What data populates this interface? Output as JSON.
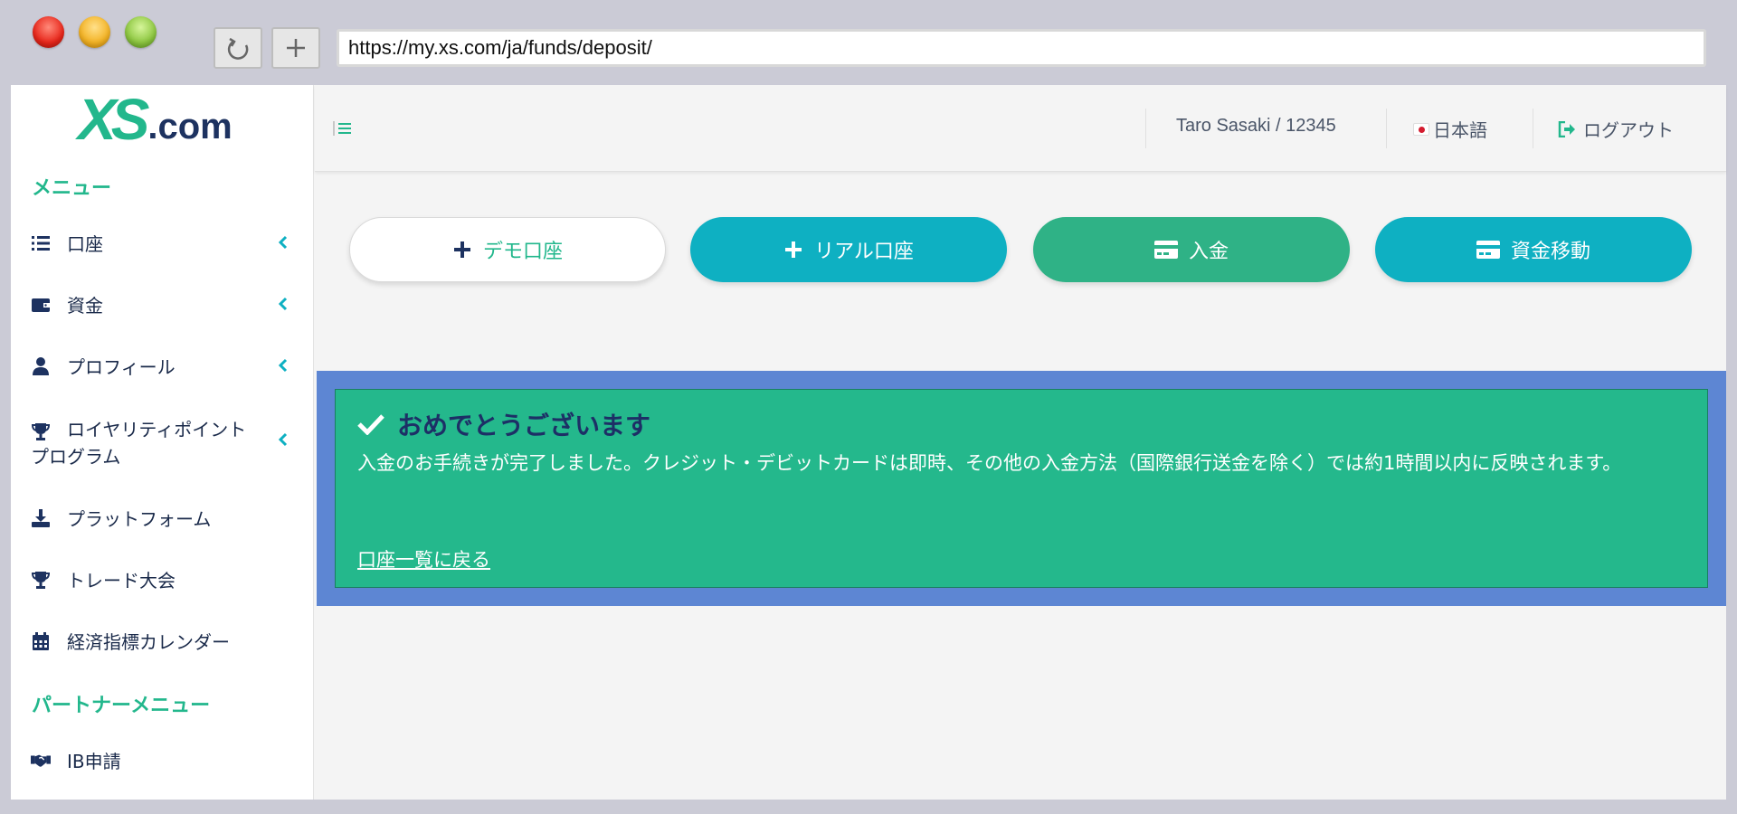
{
  "browser": {
    "url": "https://my.xs.com/ja/funds/deposit/",
    "reload_icon": "reload-icon",
    "new_tab_icon": "plus-icon"
  },
  "brand": {
    "logo_main": "XS",
    "logo_suffix": ".com",
    "primary_color": "#22b78c",
    "navy_color": "#1d3260"
  },
  "sidebar": {
    "menu_heading": "メニュー",
    "items": [
      {
        "label": "口座",
        "icon": "list-icon",
        "has_chevron": true
      },
      {
        "label": "資金",
        "icon": "wallet-icon",
        "has_chevron": true
      },
      {
        "label": "プロフィール",
        "icon": "user-icon",
        "has_chevron": true
      },
      {
        "label": "ロイヤリティポイントプログラム",
        "icon": "trophy-icon",
        "has_chevron": true
      },
      {
        "label": "プラットフォーム",
        "icon": "download-icon",
        "has_chevron": false
      },
      {
        "label": "トレード大会",
        "icon": "trophy-icon",
        "has_chevron": false
      },
      {
        "label": "経済指標カレンダー",
        "icon": "calendar-icon",
        "has_chevron": false
      }
    ],
    "partner_heading": "パートナーメニュー",
    "partner_items": [
      {
        "label": "IB申請",
        "icon": "handshake-icon"
      }
    ]
  },
  "header": {
    "menu_icon": "hamburger-icon",
    "user": "Taro Sasaki / 12345",
    "language": "日本語",
    "logout": "ログアウト"
  },
  "actions": [
    {
      "label": "デモ口座",
      "icon": "plus-icon",
      "color": "#ffffff"
    },
    {
      "label": "リアル口座",
      "icon": "plus-icon",
      "color": "#0eb0c2"
    },
    {
      "label": "入金",
      "icon": "credit-card-icon",
      "color": "#2fb286"
    },
    {
      "label": "資金移動",
      "icon": "credit-card-icon",
      "color": "#0eb0c2"
    }
  ],
  "notice": {
    "title": "おめでとうございます",
    "body": "入金のお手続きが完了しました。クレジット・デビットカードは即時、その他の入金方法（国際銀行送金を除く）では約1時間以内に反映されます。",
    "link": "口座一覧に戻る",
    "background": "#24b88c",
    "frame": "#5d86d3"
  }
}
